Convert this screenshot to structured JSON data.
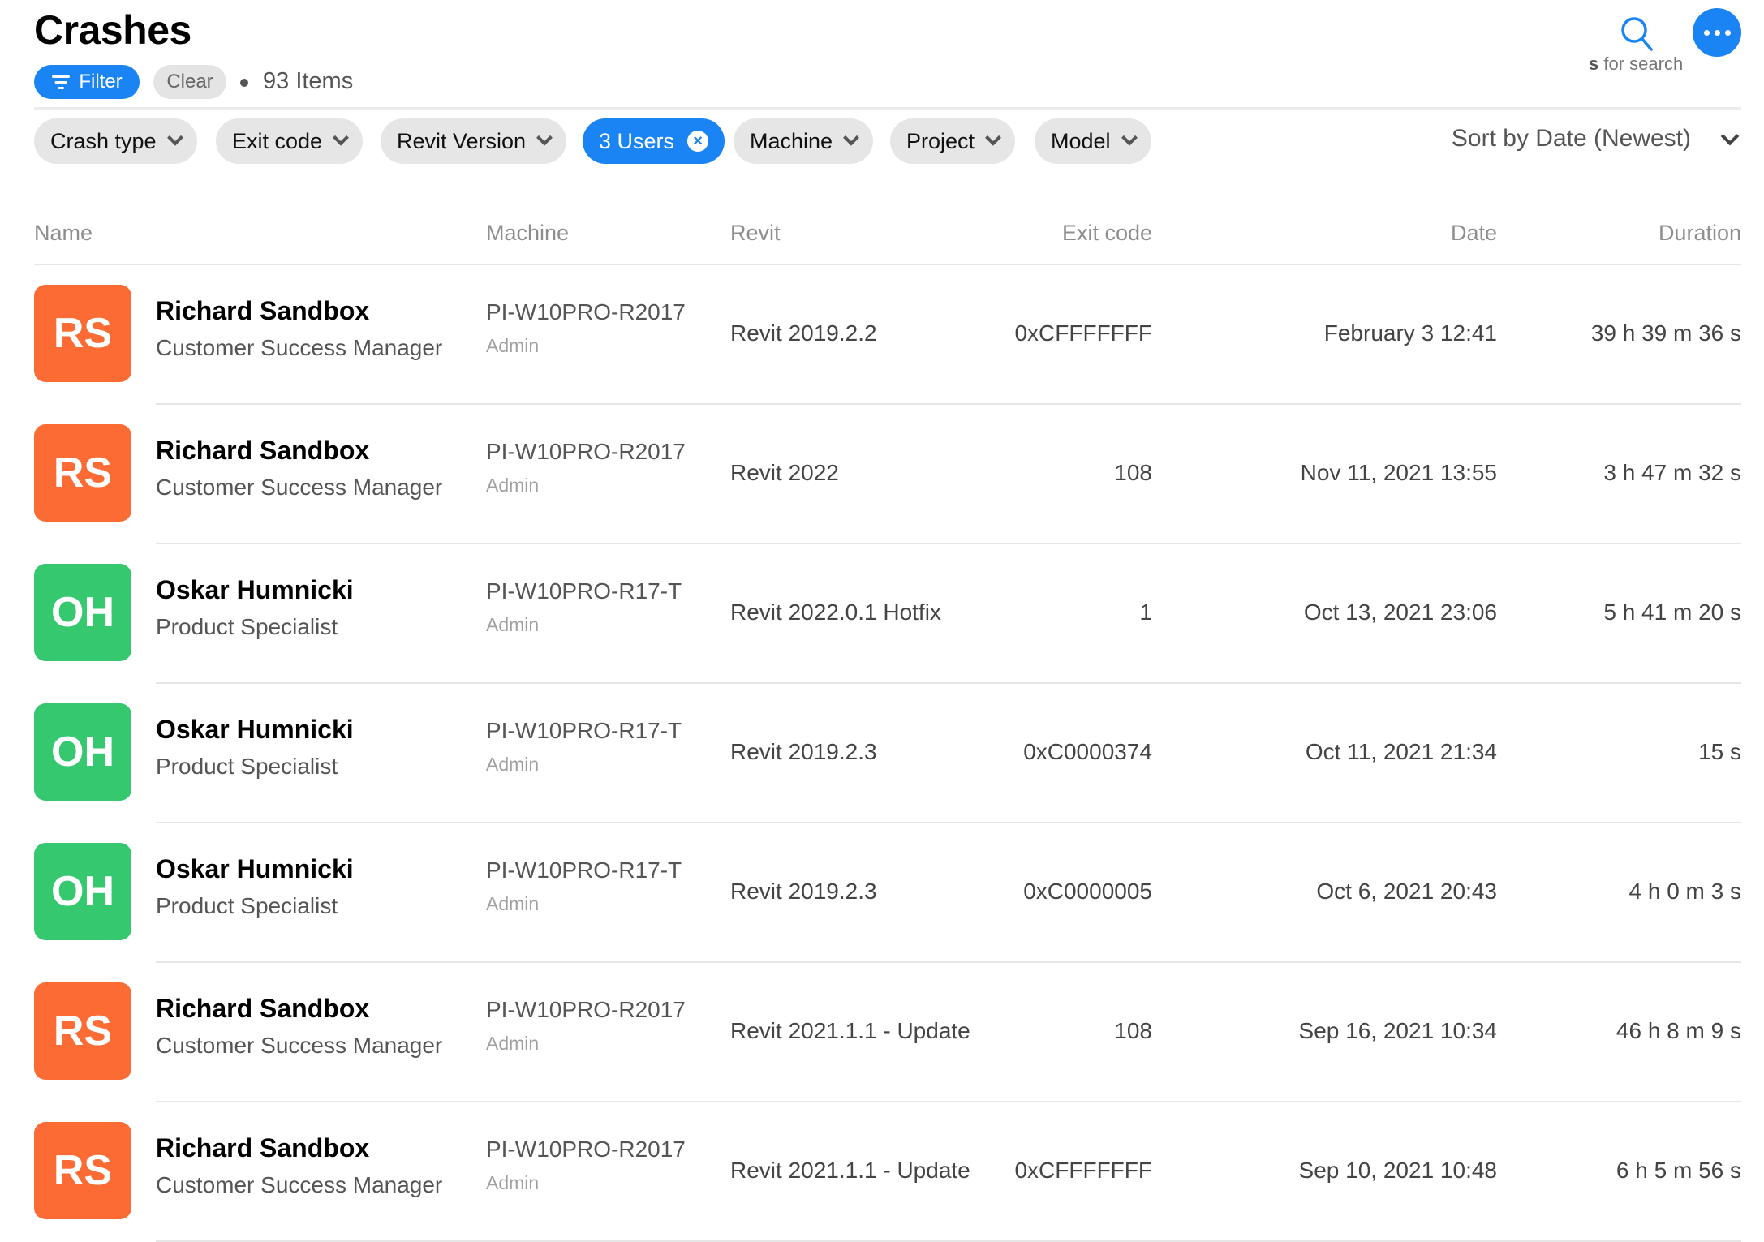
{
  "page": {
    "title": "Crashes",
    "filter_label": "Filter",
    "clear_label": "Clear",
    "items_count": "93 Items",
    "search_hint_key": "s",
    "search_hint_text": " for search",
    "sort_label": "Sort by Date (Newest)"
  },
  "colors": {
    "accent": "#1a84f5",
    "avatar_orange": "#fb6b33",
    "avatar_green": "#35c86e",
    "chip_bg": "#e6e6e6"
  },
  "filters": [
    {
      "label": "Crash type",
      "active": false
    },
    {
      "label": "Exit code",
      "active": false
    },
    {
      "label": "Revit Version",
      "active": false
    },
    {
      "label": "3 Users",
      "active": true
    },
    {
      "label": "Machine",
      "active": false
    },
    {
      "label": "Project",
      "active": false
    },
    {
      "label": "Model",
      "active": false
    }
  ],
  "table": {
    "columns": {
      "name": "Name",
      "machine": "Machine",
      "revit": "Revit",
      "exit_code": "Exit code",
      "date": "Date",
      "duration": "Duration"
    },
    "rows": [
      {
        "initials": "RS",
        "color": "#fb6b33",
        "name": "Richard Sandbox",
        "role": "Customer Success Manager",
        "machine": "PI-W10PRO-R2017",
        "machine_user": "Admin",
        "revit": "Revit 2019.2.2",
        "exit_code": "0xCFFFFFFF",
        "date": "February 3 12:41",
        "duration": "39 h 39 m 36 s"
      },
      {
        "initials": "RS",
        "color": "#fb6b33",
        "name": "Richard Sandbox",
        "role": "Customer Success Manager",
        "machine": "PI-W10PRO-R2017",
        "machine_user": "Admin",
        "revit": "Revit 2022",
        "exit_code": "108",
        "date": "Nov 11, 2021 13:55",
        "duration": "3 h 47 m 32 s"
      },
      {
        "initials": "OH",
        "color": "#35c86e",
        "name": "Oskar Humnicki",
        "role": "Product Specialist",
        "machine": "PI-W10PRO-R17-T",
        "machine_user": "Admin",
        "revit": "Revit 2022.0.1 Hotfix",
        "exit_code": "1",
        "date": "Oct 13, 2021 23:06",
        "duration": "5 h 41 m 20 s"
      },
      {
        "initials": "OH",
        "color": "#35c86e",
        "name": "Oskar Humnicki",
        "role": "Product Specialist",
        "machine": "PI-W10PRO-R17-T",
        "machine_user": "Admin",
        "revit": "Revit 2019.2.3",
        "exit_code": "0xC0000374",
        "date": "Oct 11, 2021 21:34",
        "duration": "15 s"
      },
      {
        "initials": "OH",
        "color": "#35c86e",
        "name": "Oskar Humnicki",
        "role": "Product Specialist",
        "machine": "PI-W10PRO-R17-T",
        "machine_user": "Admin",
        "revit": "Revit 2019.2.3",
        "exit_code": "0xC0000005",
        "date": "Oct 6, 2021 20:43",
        "duration": "4 h 0 m 3 s"
      },
      {
        "initials": "RS",
        "color": "#fb6b33",
        "name": "Richard Sandbox",
        "role": "Customer Success Manager",
        "machine": "PI-W10PRO-R2017",
        "machine_user": "Admin",
        "revit": "Revit 2021.1.1 - Update",
        "exit_code": "108",
        "date": "Sep 16, 2021 10:34",
        "duration": "46 h 8 m 9 s"
      },
      {
        "initials": "RS",
        "color": "#fb6b33",
        "name": "Richard Sandbox",
        "role": "Customer Success Manager",
        "machine": "PI-W10PRO-R2017",
        "machine_user": "Admin",
        "revit": "Revit 2021.1.1 - Update",
        "exit_code": "0xCFFFFFFF",
        "date": "Sep 10, 2021 10:48",
        "duration": "6 h 5 m 56 s"
      }
    ]
  }
}
